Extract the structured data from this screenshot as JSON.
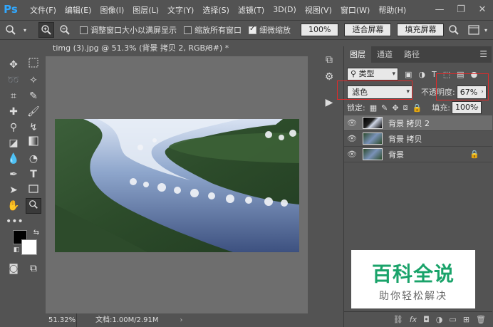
{
  "app": {
    "logo": "Ps"
  },
  "menu": [
    "文件(F)",
    "编辑(E)",
    "图像(I)",
    "图层(L)",
    "文字(Y)",
    "选择(S)",
    "滤镜(T)",
    "3D(D)",
    "视图(V)",
    "窗口(W)",
    "帮助(H)"
  ],
  "window_controls": {
    "minimize": "—",
    "restore": "❐",
    "close": "✕"
  },
  "options_bar": {
    "resize_window_label": "调整窗口大小以满屏显示",
    "zoom_all_label": "缩放所有窗口",
    "scrubby_zoom_label": "细微缩放",
    "zoom_100": "100%",
    "fit_screen": "适合屏幕",
    "fill_screen": "填充屏幕"
  },
  "document": {
    "tab_title": "timg (3).jpg @ 51.3% (背景 拷贝 2, RGB/8#) *",
    "close": "×",
    "zoom": "51.32%",
    "doc_info": "文档:1.00M/2.91M",
    "status_arrow": "›"
  },
  "layers_panel": {
    "tabs": [
      "图层",
      "通道",
      "路径"
    ],
    "filter_kind": "类型",
    "blend_mode": "滤色",
    "opacity_label": "不透明度:",
    "opacity_value": "67%",
    "lock_label": "锁定:",
    "fill_label": "填充:",
    "fill_value": "100%",
    "layers": [
      {
        "name": "背景 拷贝 2",
        "selected": true,
        "locked": false
      },
      {
        "name": "背景 拷贝",
        "selected": false,
        "locked": false
      },
      {
        "name": "背景",
        "selected": false,
        "locked": true
      }
    ]
  },
  "watermark": {
    "title": "百科全说",
    "subtitle": "助你轻松解决"
  },
  "colors": {
    "ps_blue": "#31a8ff",
    "highlight_red": "#e02a2a",
    "watermark_green": "#1aa36a"
  }
}
